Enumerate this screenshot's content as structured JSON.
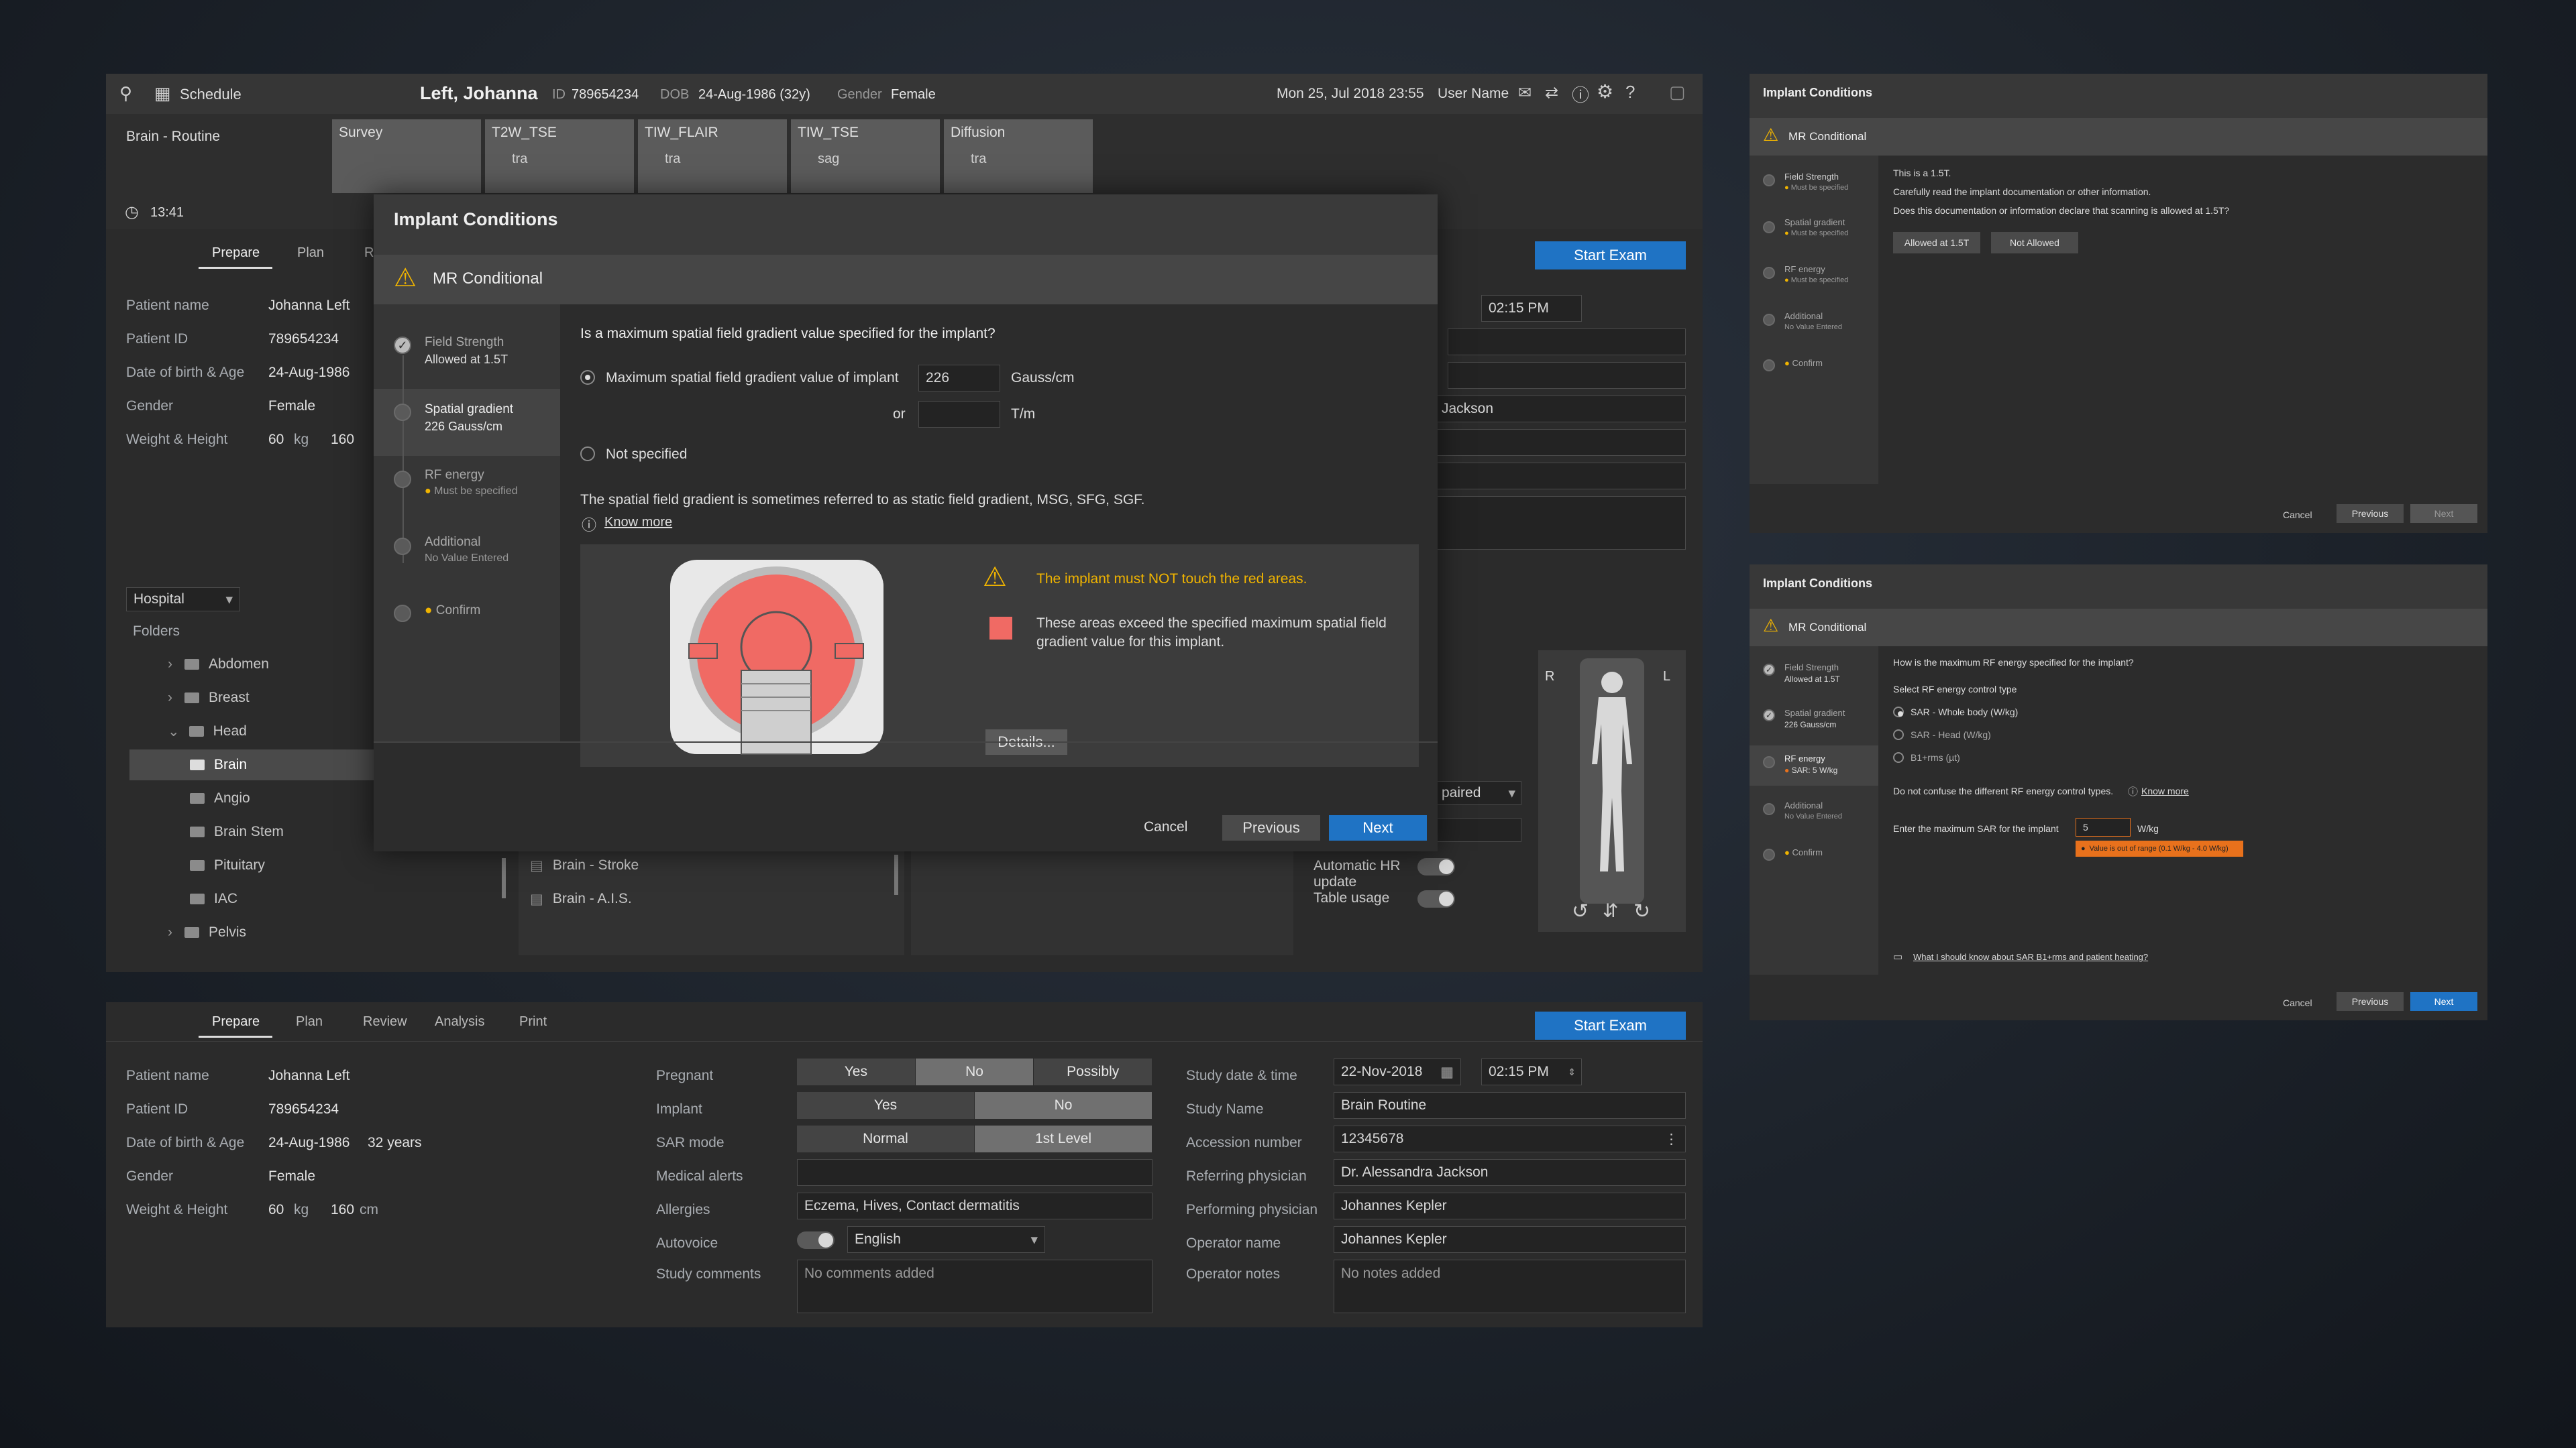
{
  "main": {
    "topbar": {
      "schedule": "Schedule",
      "patient": "Left, Johanna",
      "id_label": "ID",
      "id": "789654234",
      "dob_label": "DOB",
      "dob": "24-Aug-1986 (32y)",
      "gender_label": "Gender",
      "gender": "Female",
      "datetime": "Mon 25, Jul 2018  23:55",
      "user": "User Name"
    },
    "exam_name": "Brain - Routine",
    "timer": "13:41",
    "scans": [
      {
        "name": "Survey",
        "sub": ""
      },
      {
        "name": "T2W_TSE",
        "sub": "tra"
      },
      {
        "name": "TIW_FLAIR",
        "sub": "tra"
      },
      {
        "name": "TIW_TSE",
        "sub": "sag"
      },
      {
        "name": "Diffusion",
        "sub": "tra"
      }
    ],
    "tabs": [
      "Prepare",
      "Plan",
      "R"
    ],
    "start_exam": "Start Exam",
    "patient": {
      "name_label": "Patient name",
      "name": "Johanna Left",
      "id_label": "Patient ID",
      "id": "789654234",
      "dob_label": "Date of birth & Age",
      "dob": "24-Aug-1986",
      "gender_label": "Gender",
      "gender": "Female",
      "wh_label": "Weight & Height",
      "weight": "60",
      "kg": "kg",
      "height": "160",
      "cm": "cm"
    },
    "time": "02:15 PM",
    "ref_partial": "Jackson",
    "hospital": "Hospital",
    "folders_label": "Folders",
    "tree": [
      {
        "label": "Abdomen"
      },
      {
        "label": "Breast"
      },
      {
        "label": "Head"
      },
      {
        "label": "Brain"
      },
      {
        "label": "Angio"
      },
      {
        "label": "Brain Stem"
      },
      {
        "label": "Pituitary"
      },
      {
        "label": "IAC"
      },
      {
        "label": "Pelvis"
      }
    ],
    "protocols": [
      "Brain - Stroke",
      "Brain - A.I.S."
    ],
    "paired": "paired",
    "auto_hr": "Automatic HR update",
    "table_usage": "Table usage",
    "r": "R",
    "l": "L"
  },
  "dialog": {
    "title": "Implant Conditions",
    "mr": "MR Conditional",
    "steps": [
      {
        "title": "Field Strength",
        "sub": "Allowed at 1.5T"
      },
      {
        "title": "Spatial gradient",
        "sub": "226 Gauss/cm"
      },
      {
        "title": "RF energy",
        "sub": "Must be specified"
      },
      {
        "title": "Additional",
        "sub": "No Value Entered"
      },
      {
        "title": "Confirm",
        "sub": ""
      }
    ],
    "question": "Is a maximum spatial field gradient value specified for the implant?",
    "opt1": "Maximum spatial field gradient value of implant",
    "value": "226",
    "unit1": "Gauss/cm",
    "or": "or",
    "unit2": "T/m",
    "opt2": "Not specified",
    "note": "The spatial field gradient is sometimes referred to as static field gradient, MSG, SFG, SGF.",
    "know_more": "Know more",
    "warn": "The implant must NOT touch the red areas.",
    "legend": "These areas exceed the specified maximum spatial field gradient value for this implant.",
    "details": "Details...",
    "cancel": "Cancel",
    "previous": "Previous",
    "next": "Next"
  },
  "bottom": {
    "tabs": [
      "Prepare",
      "Plan",
      "Review",
      "Analysis",
      "Print"
    ],
    "start_exam": "Start Exam",
    "patient": {
      "name_label": "Patient name",
      "name": "Johanna Left",
      "id_label": "Patient ID",
      "id": "789654234",
      "dob_label": "Date of birth & Age",
      "dob": "24-Aug-1986",
      "age": "32 years",
      "gender_label": "Gender",
      "gender": "Female",
      "wh_label": "Weight & Height",
      "weight": "60",
      "kg": "kg",
      "height": "160",
      "cm": "cm"
    },
    "pregnant_label": "Pregnant",
    "pregnant": [
      "Yes",
      "No",
      "Possibly"
    ],
    "implant_label": "Implant",
    "implant": [
      "Yes",
      "No"
    ],
    "sar_label": "SAR mode",
    "sar": [
      "Normal",
      "1st Level"
    ],
    "alerts_label": "Medical alerts",
    "allergies_label": "Allergies",
    "allergies": "Eczema, Hives, Contact dermatitis",
    "autovoice_label": "Autovoice",
    "language": "English",
    "comments_label": "Study comments",
    "comments_ph": "No comments added",
    "study_dt_label": "Study date & time",
    "date": "22-Nov-2018",
    "time": "02:15 PM",
    "study_name_label": "Study Name",
    "study_name": "Brain Routine",
    "acc_label": "Accession number",
    "acc": "12345678",
    "ref_label": "Referring physician",
    "ref": "Dr. Alessandra Jackson",
    "perf_label": "Performing physician",
    "perf": "Johannes Kepler",
    "op_label": "Operator name",
    "op": "Johannes Kepler",
    "notes_label": "Operator notes",
    "notes_ph": "No notes added"
  },
  "right1": {
    "title": "Implant Conditions",
    "mr": "MR Conditional",
    "steps": [
      {
        "title": "Field Strength",
        "sub": "Must be specified"
      },
      {
        "title": "Spatial gradient",
        "sub": "Must be specified"
      },
      {
        "title": "RF energy",
        "sub": "Must be specified"
      },
      {
        "title": "Additional",
        "sub": "No Value Entered"
      },
      {
        "title": "Confirm",
        "sub": ""
      }
    ],
    "line1": "This is a 1.5T.",
    "line2": "Carefully read the implant documentation or other information.",
    "line3": "Does this documentation or information declare that scanning is allowed at 1.5T?",
    "allowed": "Allowed at 1.5T",
    "not_allowed": "Not Allowed",
    "cancel": "Cancel",
    "previous": "Previous",
    "next": "Next"
  },
  "right2": {
    "title": "Implant Conditions",
    "mr": "MR Conditional",
    "steps": [
      {
        "title": "Field Strength",
        "sub": "Allowed at 1.5T"
      },
      {
        "title": "Spatial gradient",
        "sub": "226 Gauss/cm"
      },
      {
        "title": "RF energy",
        "sub": "SAR: 5 W/kg"
      },
      {
        "title": "Additional",
        "sub": "No Value Entered"
      },
      {
        "title": "Confirm",
        "sub": ""
      }
    ],
    "question": "How is the maximum RF energy specified for the implant?",
    "select": "Select RF energy control type",
    "opts": [
      "SAR - Whole body (W/kg)",
      "SAR - Head (W/kg)",
      "B1+rms (µt)"
    ],
    "note": "Do not confuse the different RF energy control types.",
    "know_more": "Know more",
    "enter": "Enter the maximum SAR for the implant",
    "sar_value": "5",
    "unit": "W/kg",
    "error": "Value is out of range (0.1 W/kg - 4.0 W/kg)",
    "link": "What I should know about SAR B1+rms and patient heating?",
    "cancel": "Cancel",
    "previous": "Previous",
    "next": "Next"
  },
  "colors": {
    "accent": "#1f73c4",
    "warning": "#f0b400",
    "red": "#f0605e",
    "error": "#e8711c"
  }
}
